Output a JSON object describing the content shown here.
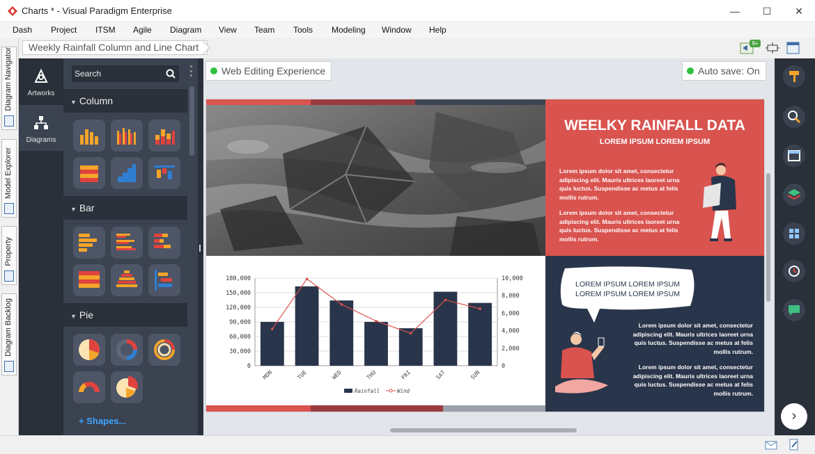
{
  "window": {
    "title": "Charts * - Visual Paradigm Enterprise",
    "minimize": "—",
    "maximize": "☐",
    "close": "✕"
  },
  "menu": [
    "Dash",
    "Project",
    "ITSM",
    "Agile",
    "Diagram",
    "View",
    "Team",
    "Tools",
    "Modeling",
    "Window",
    "Help"
  ],
  "breadcrumb": "Weekly Rainfall Column and Line Chart",
  "toolbar_badge": "9+",
  "left_tabs": [
    "Diagram Navigator",
    "Model Explorer",
    "Property",
    "Diagram Backlog"
  ],
  "rail": {
    "artworks": "Artworks",
    "diagrams": "Diagrams"
  },
  "panel": {
    "search_placeholder": "Search",
    "categories": [
      "Column",
      "Bar",
      "Pie"
    ],
    "shapes_link": "+ Shapes..."
  },
  "canvas": {
    "web_editing": "Web Editing Experience",
    "autosave": "Auto save: On"
  },
  "infographic": {
    "title": "WEELKY RAINFALL DATA",
    "subtitle": "LOREM IPSUM LOREM IPSUM",
    "para1": "Lorem ipsum dolor sit amet, consectetur adipiscing elit. Mauris ultrices laoreet urna quis luctus. Suspendisse ac metus at felis mollis rutrum.",
    "para2": "Lorem ipsum dolor sit amet, consectetur adipiscing elit. Mauris ultrices laoreet urna quis luctus. Suspendisse ac metus at felis mollis rutrum.",
    "bubble": "LOREM IPSUM LOREM IPSUM LOREM IPSUM LOREM IPSUM",
    "para3": "Lorem ipsum dolor sit amet, consectetur adipiscing elit. Mauris ultrices laoreet urna quis luctus. Suspendisse ac metus at felis mollis rutrum.",
    "para4": "Lorem ipsum dolor sit amet, consectetur adipiscing elit. Mauris ultrices laoreet urna quis luctus. Suspendisse ac metus at felis mollis rutrum.",
    "colors": {
      "red": "#d9534f",
      "navy": "#29354a",
      "bar": "#29354a",
      "line": "#d9534f"
    }
  },
  "chart_data": {
    "type": "bar",
    "categories": [
      "MON",
      "TUE",
      "WED",
      "THU",
      "FRI",
      "SAT",
      "SUN"
    ],
    "series": [
      {
        "name": "Rainfall",
        "type": "bar",
        "axis": "left",
        "values": [
          90000,
          163000,
          134000,
          90000,
          77000,
          152000,
          129000
        ]
      },
      {
        "name": "Wind",
        "type": "line",
        "axis": "right",
        "values": [
          4200,
          9900,
          7000,
          5100,
          3700,
          7500,
          6500
        ]
      }
    ],
    "ylim": [
      0,
      180000
    ],
    "y_ticks": [
      "180,000",
      "150,000",
      "120,000",
      "90,000",
      "60,000",
      "30,000",
      "0"
    ],
    "y2lim": [
      0,
      10000
    ],
    "y2_ticks": [
      "10,000",
      "8,000",
      "6,000",
      "4,000",
      "2,000",
      "0"
    ],
    "grid": true,
    "legend": "bottom"
  }
}
